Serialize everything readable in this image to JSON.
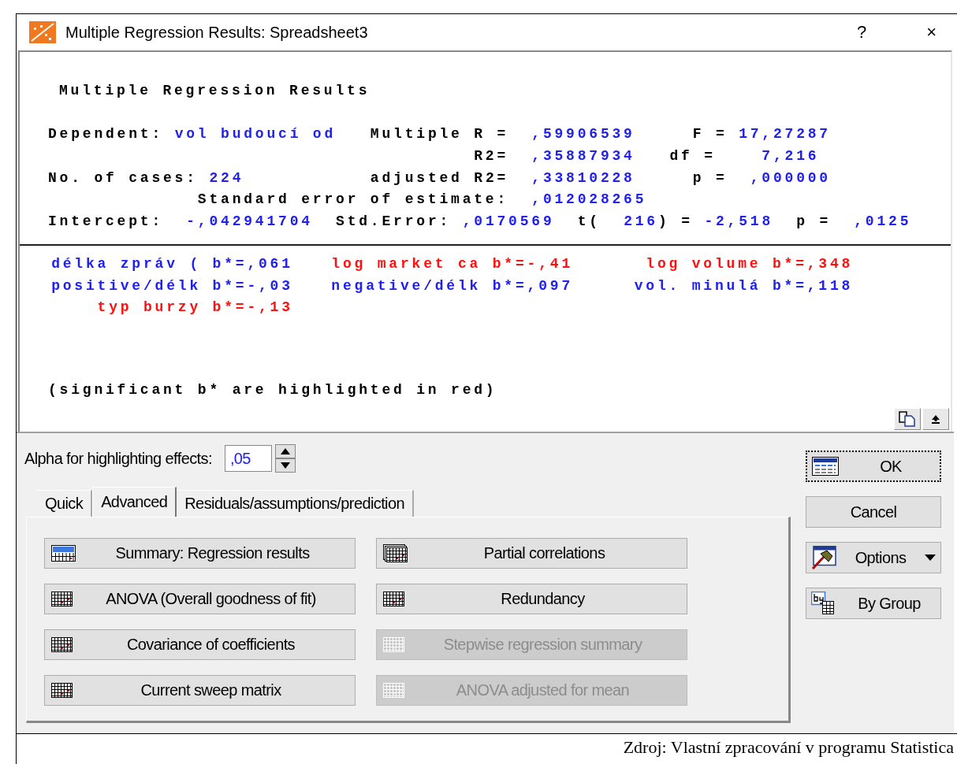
{
  "window": {
    "title": "Multiple Regression Results: Spreadsheet3",
    "help_button": "?",
    "close_button": "×"
  },
  "report": {
    "title": "Multiple Regression Results",
    "lines": [
      [
        {
          "kind": "label",
          "text": "Dependent: "
        },
        {
          "kind": "value",
          "text": "vol budoucí od"
        },
        {
          "kind": "label",
          "text": "   Multiple R =  "
        },
        {
          "kind": "value",
          "text": ",59906539"
        },
        {
          "kind": "label",
          "text": "     F = "
        },
        {
          "kind": "value",
          "text": "17,27287"
        }
      ],
      [
        {
          "kind": "label",
          "text": "                                     R2=  "
        },
        {
          "kind": "value",
          "text": ",35887934"
        },
        {
          "kind": "label",
          "text": "   df =    "
        },
        {
          "kind": "value",
          "text": "7,216"
        }
      ],
      [
        {
          "kind": "label",
          "text": "No. of cases: "
        },
        {
          "kind": "value",
          "text": "224"
        },
        {
          "kind": "label",
          "text": "           adjusted R2=  "
        },
        {
          "kind": "value",
          "text": ",33810228"
        },
        {
          "kind": "label",
          "text": "     p =  "
        },
        {
          "kind": "value",
          "text": ",000000"
        }
      ],
      [
        {
          "kind": "label",
          "text": "             Standard error of estimate:  "
        },
        {
          "kind": "value",
          "text": ",012028265"
        }
      ],
      [
        {
          "kind": "label",
          "text": "Intercept:  "
        },
        {
          "kind": "value",
          "text": "-,042941704"
        },
        {
          "kind": "label",
          "text": "  Std.Error: "
        },
        {
          "kind": "value",
          "text": ",0170569"
        },
        {
          "kind": "label",
          "text": "  t(  "
        },
        {
          "kind": "value",
          "text": "216"
        },
        {
          "kind": "label",
          "text": ") = "
        },
        {
          "kind": "value",
          "text": "-2,518"
        },
        {
          "kind": "label",
          "text": "  p =  "
        },
        {
          "kind": "value",
          "text": ",0125"
        }
      ]
    ],
    "coefficients": [
      {
        "text": "délka zpráv ( b*=,061",
        "significant": false
      },
      {
        "text": "log market ca b*=-,41",
        "significant": true
      },
      {
        "text": "log volume b*=,348",
        "significant": true
      },
      {
        "text": "positive/délk b*=-,03",
        "significant": false
      },
      {
        "text": "negative/délk b*=,097",
        "significant": false
      },
      {
        "text": "vol. minulá b*=,118",
        "significant": false
      },
      {
        "text": "typ burzy b*=-,13",
        "significant": true
      }
    ],
    "note": "(significant b* are highlighted in red)"
  },
  "alpha": {
    "label": "Alpha for highlighting effects:",
    "value": ",05"
  },
  "tabs": [
    {
      "label": "Quick",
      "selected": false
    },
    {
      "label": "Advanced",
      "selected": true
    },
    {
      "label": "Residuals/assumptions/prediction",
      "selected": false
    }
  ],
  "actions": [
    {
      "label": "Summary:  Regression results",
      "kind": "summary",
      "disabled": false
    },
    {
      "label": "Partial correlations",
      "kind": "stacked",
      "disabled": false
    },
    {
      "label": "ANOVA (Overall goodness of fit)",
      "kind": "grid",
      "disabled": false
    },
    {
      "label": "Redundancy",
      "kind": "grid",
      "disabled": false
    },
    {
      "label": "Covariance of coefficients",
      "kind": "grid",
      "disabled": false
    },
    {
      "label": "Stepwise regression summary",
      "kind": "grid",
      "disabled": true
    },
    {
      "label": "Current sweep matrix",
      "kind": "grid",
      "disabled": false
    },
    {
      "label": "ANOVA adjusted for mean",
      "kind": "grid",
      "disabled": true
    }
  ],
  "side_buttons": [
    {
      "label": "OK",
      "kind": "table",
      "focused": true
    },
    {
      "label": "Cancel",
      "kind": "plain",
      "focused": false
    },
    {
      "label": "Options",
      "kind": "options",
      "focused": false
    },
    {
      "label": "By Group",
      "kind": "bygroup",
      "focused": false
    }
  ],
  "caption": "Zdroj: Vlastní zpracování v programu Statistica"
}
